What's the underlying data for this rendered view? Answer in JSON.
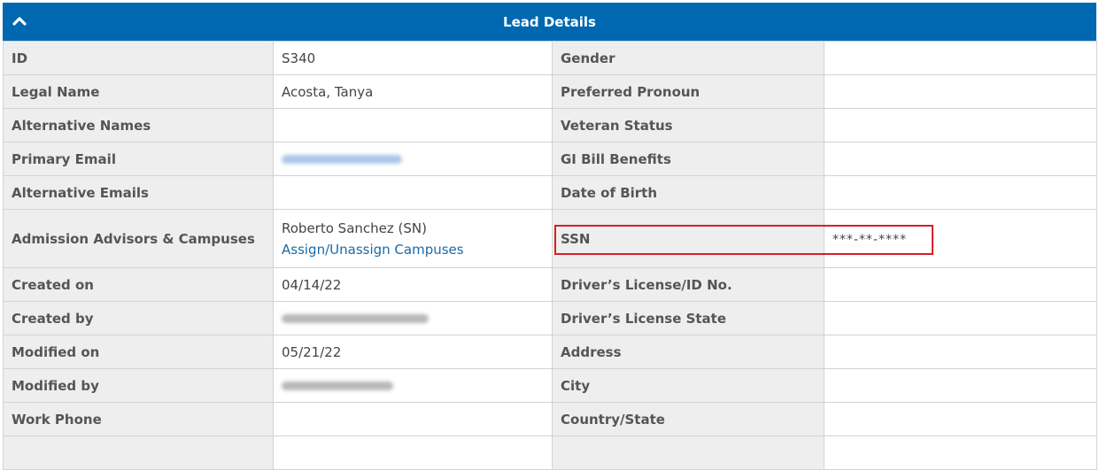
{
  "header": {
    "title": "Lead Details",
    "collapse_icon": "chevron-up-icon"
  },
  "rows": [
    {
      "left_label": "ID",
      "left_value": "S340",
      "right_label": "Gender",
      "right_value": ""
    },
    {
      "left_label": "Legal Name",
      "left_value": "Acosta, Tanya",
      "right_label": "Preferred Pronoun",
      "right_value": ""
    },
    {
      "left_label": "Alternative Names",
      "left_value": "",
      "right_label": "Veteran Status",
      "right_value": ""
    },
    {
      "left_label": "Primary Email",
      "left_value": "",
      "right_label": "GI Bill Benefits",
      "right_value": ""
    },
    {
      "left_label": "Alternative Emails",
      "left_value": "",
      "right_label": "Date of Birth",
      "right_value": ""
    },
    {
      "left_label": "Admission Advisors & Campuses",
      "left_value": "Roberto Sanchez (SN)",
      "left_link": "Assign/Unassign Campuses",
      "right_label": "SSN",
      "right_value": "***-**-****"
    },
    {
      "left_label": "Created on",
      "left_value": "04/14/22",
      "right_label": "Driver’s License/ID No.",
      "right_value": ""
    },
    {
      "left_label": "Created by",
      "left_value": "",
      "right_label": "Driver’s License State",
      "right_value": ""
    },
    {
      "left_label": "Modified on",
      "left_value": "05/21/22",
      "right_label": "Address",
      "right_value": ""
    },
    {
      "left_label": "Modified by",
      "left_value": "",
      "right_label": "City",
      "right_value": ""
    },
    {
      "left_label": "Work Phone",
      "left_value": "",
      "right_label": "Country/State",
      "right_value": ""
    },
    {
      "left_label": "",
      "left_value": "",
      "right_label": "",
      "right_value": ""
    }
  ],
  "colors": {
    "header_bg": "#0067b1",
    "label_bg": "#eeeeee",
    "highlight": "#d51f2a",
    "link": "#1a6aa8"
  }
}
